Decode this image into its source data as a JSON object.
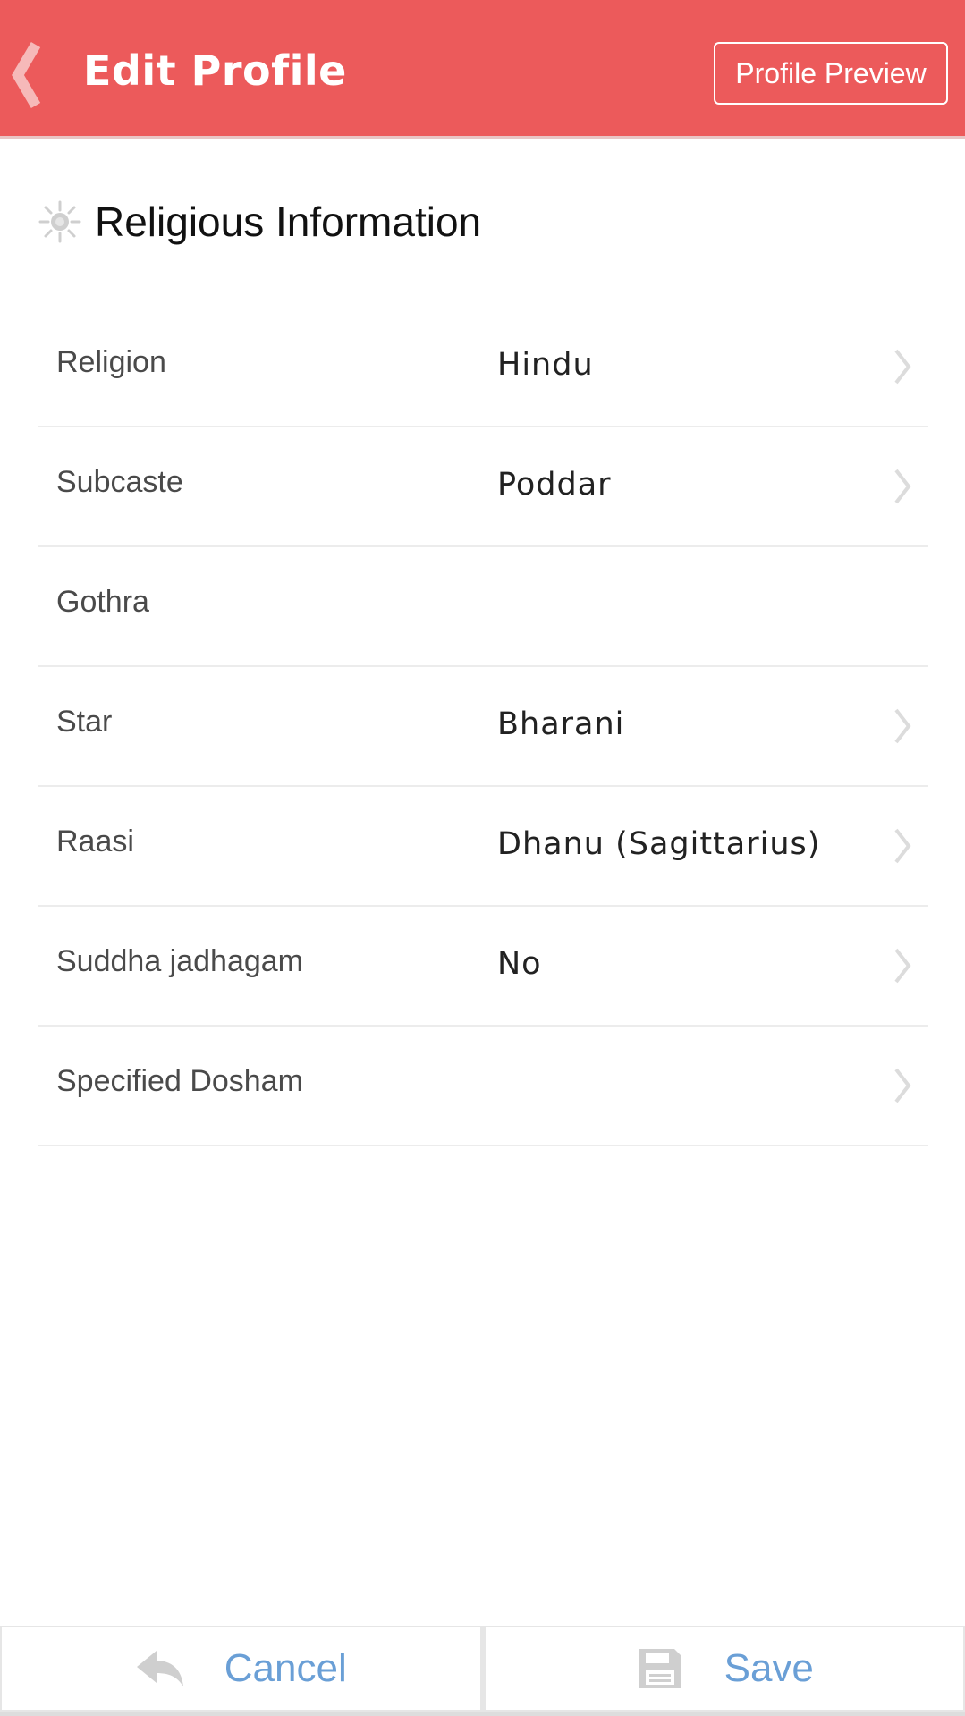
{
  "app_bar": {
    "title": "Edit Profile",
    "preview_button": "Profile Preview",
    "background_color": "#ec5a5b",
    "back_icon": "chevron-left-icon"
  },
  "section": {
    "title": "Religious Information",
    "icon": "sun-icon"
  },
  "rows": [
    {
      "label": "Religion",
      "value": "Hindu",
      "has_chevron": true
    },
    {
      "label": "Subcaste",
      "value": "Poddar",
      "has_chevron": true
    },
    {
      "label": "Gothra",
      "value": "",
      "has_chevron": false
    },
    {
      "label": "Star",
      "value": "Bharani",
      "has_chevron": true
    },
    {
      "label": "Raasi",
      "value": "Dhanu (Sagittarius)",
      "has_chevron": true
    },
    {
      "label": "Suddha jadhagam",
      "value": "No",
      "has_chevron": true
    },
    {
      "label": "Specified Dosham",
      "value": "",
      "has_chevron": true
    }
  ],
  "bottom_bar": {
    "cancel_label": "Cancel",
    "cancel_icon": "reply-arrow-icon",
    "save_label": "Save",
    "save_icon": "floppy-disk-icon",
    "label_color": "#6a9fd6"
  }
}
